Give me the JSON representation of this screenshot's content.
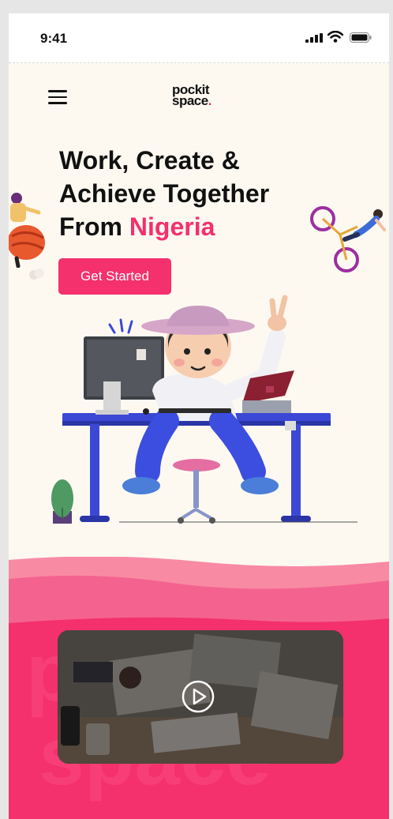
{
  "status_bar": {
    "time": "9:41"
  },
  "header": {
    "logo_line1": "pockit",
    "logo_line2": "space",
    "logo_dot": "."
  },
  "hero": {
    "headline_line1": "Work, Create &",
    "headline_line2": "Achieve Together",
    "headline_prefix": "From ",
    "headline_accent": "Nigeria",
    "cta_label": "Get Started"
  },
  "colors": {
    "accent": "#f4306d",
    "background": "#fdf9f1",
    "wave_light": "#f98aa3"
  },
  "icons": [
    "hamburger-menu-icon",
    "cellular-signal-icon",
    "wifi-icon",
    "battery-icon",
    "play-icon"
  ]
}
